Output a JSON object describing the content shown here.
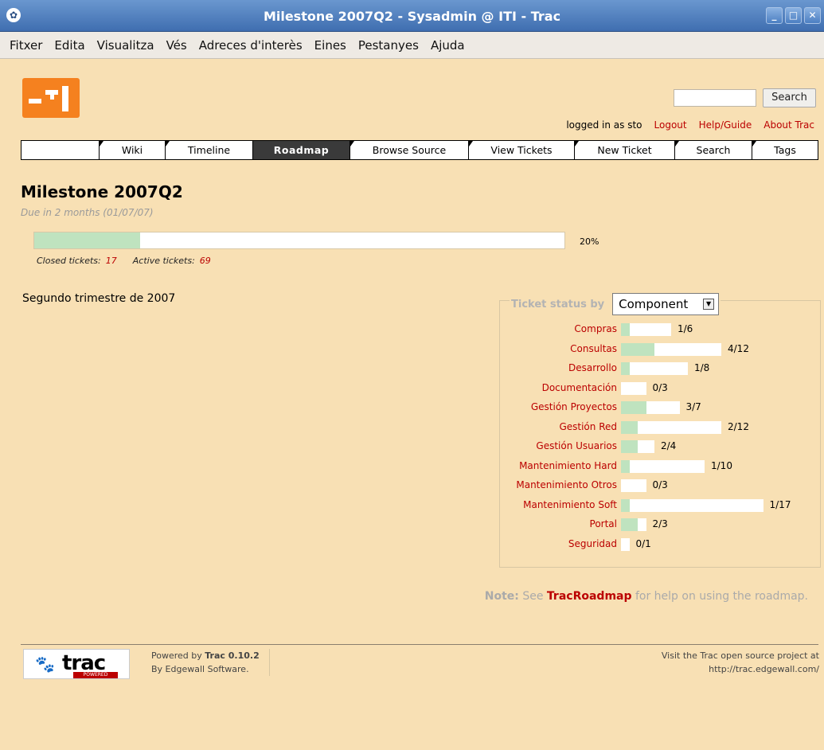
{
  "window": {
    "title": "Milestone 2007Q2 - Sysadmin @ ITI - Trac"
  },
  "menu": [
    "Fitxer",
    "Edita",
    "Visualitza",
    "Vés",
    "Adreces d'interès",
    "Eines",
    "Pestanyes",
    "Ajuda"
  ],
  "search": {
    "button": "Search",
    "value": ""
  },
  "metanav": {
    "user": "logged in as sto",
    "logout": "Logout",
    "help": "Help/Guide",
    "about": "About Trac"
  },
  "mainnav": [
    "",
    "Wiki",
    "Timeline",
    "Roadmap",
    "Browse Source",
    "View Tickets",
    "New Ticket",
    "Search",
    "Tags"
  ],
  "milestone": {
    "title": "Milestone 2007Q2",
    "due": "Due in 2 months (01/07/07)",
    "percent": "20%",
    "progress_fraction": 0.2,
    "closed_label": "Closed tickets:",
    "closed": "17",
    "active_label": "Active tickets:",
    "active": "69",
    "description": "Segundo trimestre de 2007"
  },
  "stats": {
    "label": "Ticket status by",
    "group_by": "Component",
    "rows": [
      {
        "name": "Compras",
        "closed": 1,
        "total": 6,
        "ratio": "1/6"
      },
      {
        "name": "Consultas",
        "closed": 4,
        "total": 12,
        "ratio": "4/12"
      },
      {
        "name": "Desarrollo",
        "closed": 1,
        "total": 8,
        "ratio": "1/8"
      },
      {
        "name": "Documentación",
        "closed": 0,
        "total": 3,
        "ratio": "0/3"
      },
      {
        "name": "Gestión Proyectos",
        "closed": 3,
        "total": 7,
        "ratio": "3/7"
      },
      {
        "name": "Gestión Red",
        "closed": 2,
        "total": 12,
        "ratio": "2/12"
      },
      {
        "name": "Gestión Usuarios",
        "closed": 2,
        "total": 4,
        "ratio": "2/4"
      },
      {
        "name": "Mantenimiento Hard",
        "closed": 1,
        "total": 10,
        "ratio": "1/10"
      },
      {
        "name": "Mantenimiento Otros",
        "closed": 0,
        "total": 3,
        "ratio": "0/3"
      },
      {
        "name": "Mantenimiento Soft",
        "closed": 1,
        "total": 17,
        "ratio": "1/17"
      },
      {
        "name": "Portal",
        "closed": 2,
        "total": 3,
        "ratio": "2/3"
      },
      {
        "name": "Seguridad",
        "closed": 0,
        "total": 1,
        "ratio": "0/1"
      }
    ]
  },
  "note": {
    "label": "Note:",
    "pre": "See",
    "link": "TracRoadmap",
    "post": "for help on using the roadmap."
  },
  "footer": {
    "powered_pre": "Powered by",
    "powered_name": "Trac 0.10.2",
    "by": "By Edgewall Software.",
    "visit": "Visit the Trac open source project at",
    "url": "http://trac.edgewall.com/",
    "logo_text": "trac",
    "logo_badge": "POWERED"
  },
  "colors": {
    "accent_link": "#bb0000",
    "page_bg": "#f8e0b4",
    "progress_done": "#bfe3bf"
  }
}
